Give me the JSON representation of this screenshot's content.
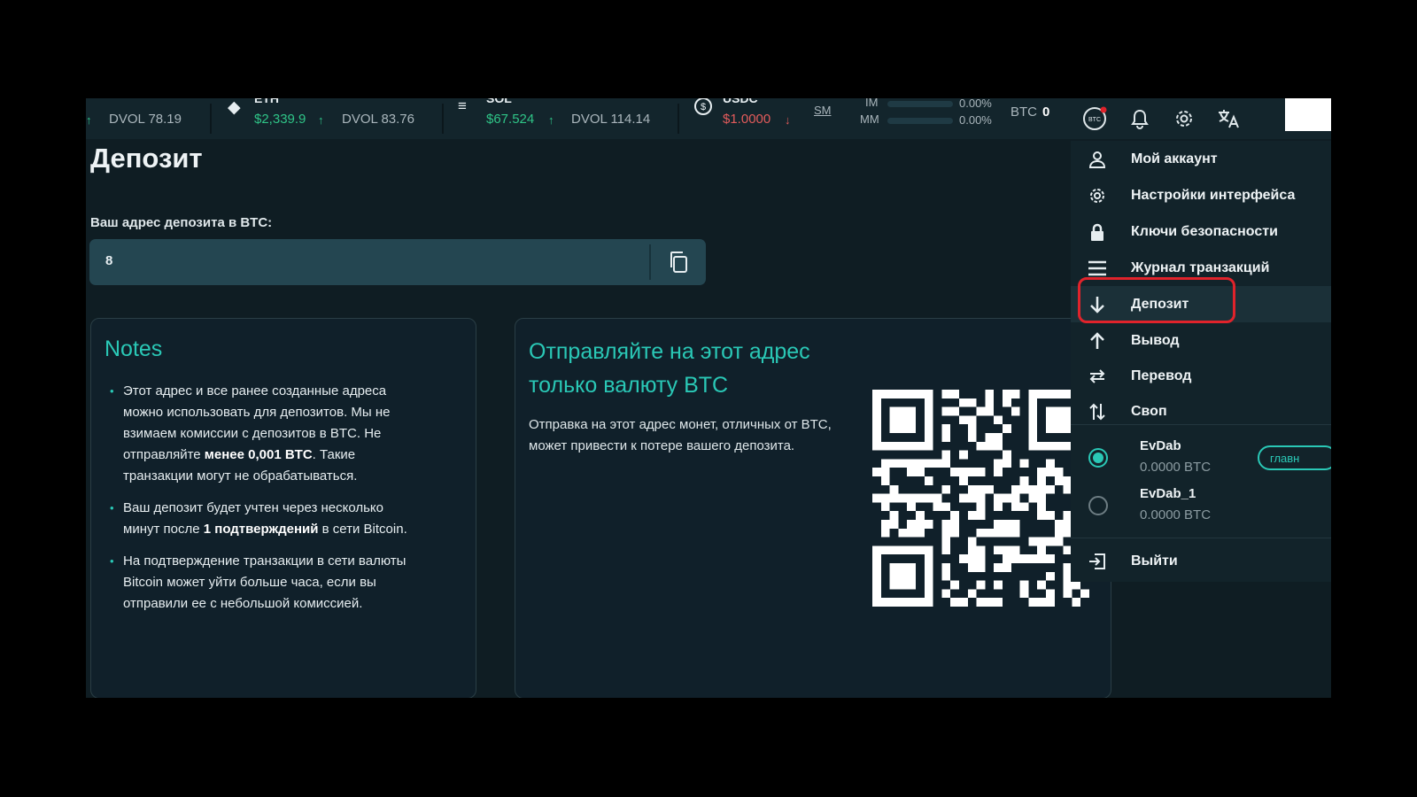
{
  "ticker": {
    "items": [
      {
        "name": "",
        "price": "",
        "dvol": "DVOL 78.19"
      },
      {
        "name": "ETH",
        "price": "$2,339.9",
        "dvol": "DVOL 83.76"
      },
      {
        "name": "SOL",
        "price": "$67.524",
        "dvol": "DVOL 114.14"
      },
      {
        "name": "USDC",
        "price": "$1.0000",
        "dvol": ""
      }
    ],
    "sm_label": "SM",
    "im_label": "IM",
    "mm_label": "MM",
    "im_value": "0.00%",
    "mm_value": "0.00%",
    "btc_label": "BTC",
    "btc_value": "0"
  },
  "page": {
    "title": "Депозит",
    "address_label": "Ваш адрес депозита в BTC:",
    "address_value": "8"
  },
  "notes": {
    "title": "Notes",
    "items": [
      {
        "text_a": "Этот адрес и все ранее созданные адреса можно использовать для депозитов. Мы не взимаем комиссии с депозитов в BTC. Не отправляйте ",
        "bold": "менее 0,001 BTC",
        "text_b": ". Такие транзакции могут не обрабатываться."
      },
      {
        "text_a": "Ваш депозит будет учтен через несколько минут после ",
        "bold": "1 подтверждений",
        "text_b": " в сети Bitcoin."
      },
      {
        "text_a": "На подтверждение транзакции в сети валюты Bitcoin может уйти больше часа, если вы отправили ее с небольшой комиссией.",
        "bold": "",
        "text_b": ""
      }
    ]
  },
  "send": {
    "title": "Отправляйте на этот адрес только валюту BTC",
    "warning": "Отправка на этот адрес монет, отличных от BTC, может привести к потере вашего депозита."
  },
  "menu": {
    "items": [
      {
        "label": "Мой аккаунт",
        "icon": "user-icon"
      },
      {
        "label": "Настройки интерфейса",
        "icon": "gear-icon"
      },
      {
        "label": "Ключи безопасности",
        "icon": "lock-icon"
      },
      {
        "label": "Журнал транзакций",
        "icon": "list-icon"
      },
      {
        "label": "Депозит",
        "icon": "arrow-down-icon"
      },
      {
        "label": "Вывод",
        "icon": "arrow-up-icon"
      },
      {
        "label": "Перевод",
        "icon": "transfer-icon"
      },
      {
        "label": "Своп",
        "icon": "swap-icon"
      }
    ],
    "accounts": [
      {
        "name": "EvDab",
        "balance": "0.0000 BTC",
        "badge": "главн",
        "selected": true
      },
      {
        "name": "EvDab_1",
        "balance": "0.0000 BTC",
        "badge": "",
        "selected": false
      }
    ],
    "logout_label": "Выйти"
  },
  "colors": {
    "accent": "#2ac8b6",
    "up": "#2fc487",
    "down": "#e25b5b",
    "highlight": "#e0232b",
    "background": "#0f1d23"
  }
}
